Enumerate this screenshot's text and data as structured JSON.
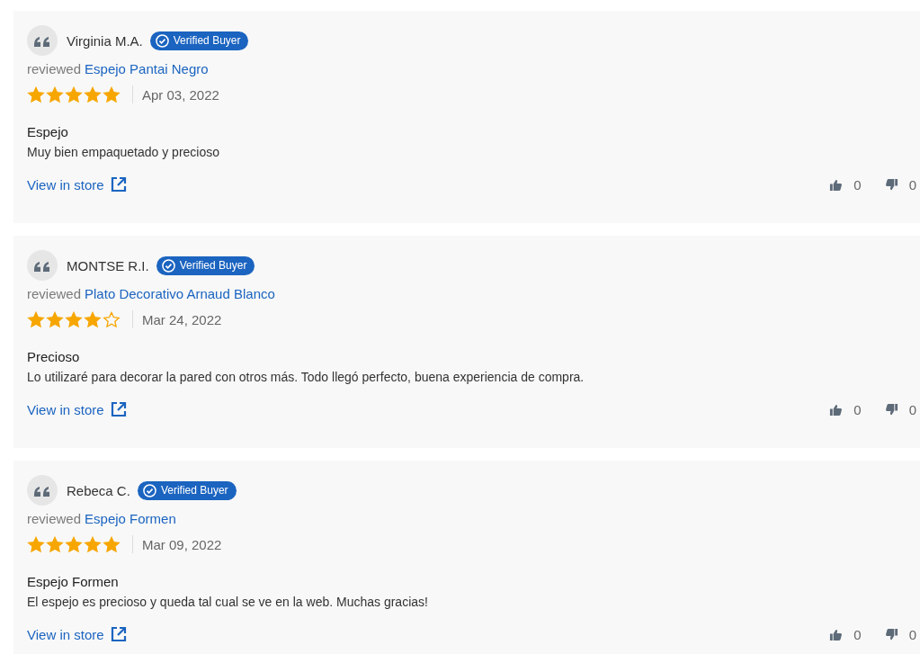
{
  "reviews": [
    {
      "author": "Virginia M.A.",
      "badge": "Verified Buyer",
      "reviewed_label": "reviewed",
      "product": "Espejo Pantai Negro",
      "stars": 5,
      "date": "Apr 03, 2022",
      "title": "Espejo",
      "body": "Muy bien empaquetado y precioso",
      "link": "View in store",
      "upvotes": "0",
      "downvotes": "0"
    },
    {
      "author": "MONTSE R.I.",
      "badge": "Verified Buyer",
      "reviewed_label": "reviewed",
      "product": "Plato Decorativo Arnaud Blanco",
      "stars": 4,
      "date": "Mar 24, 2022",
      "title": "Precioso",
      "body": "Lo utilizaré para decorar la pared con otros más. Todo llegó perfecto, buena experiencia de compra.",
      "link": "View in store",
      "upvotes": "0",
      "downvotes": "0"
    },
    {
      "author": "Rebeca C.",
      "badge": "Verified Buyer",
      "reviewed_label": "reviewed",
      "product": "Espejo Formen",
      "stars": 5,
      "date": "Mar 09, 2022",
      "title": "Espejo Formen",
      "body": "El espejo es precioso y queda tal cual se ve en la web. Muchas gracias!",
      "link": "View in store",
      "upvotes": "0",
      "downvotes": "0"
    }
  ]
}
